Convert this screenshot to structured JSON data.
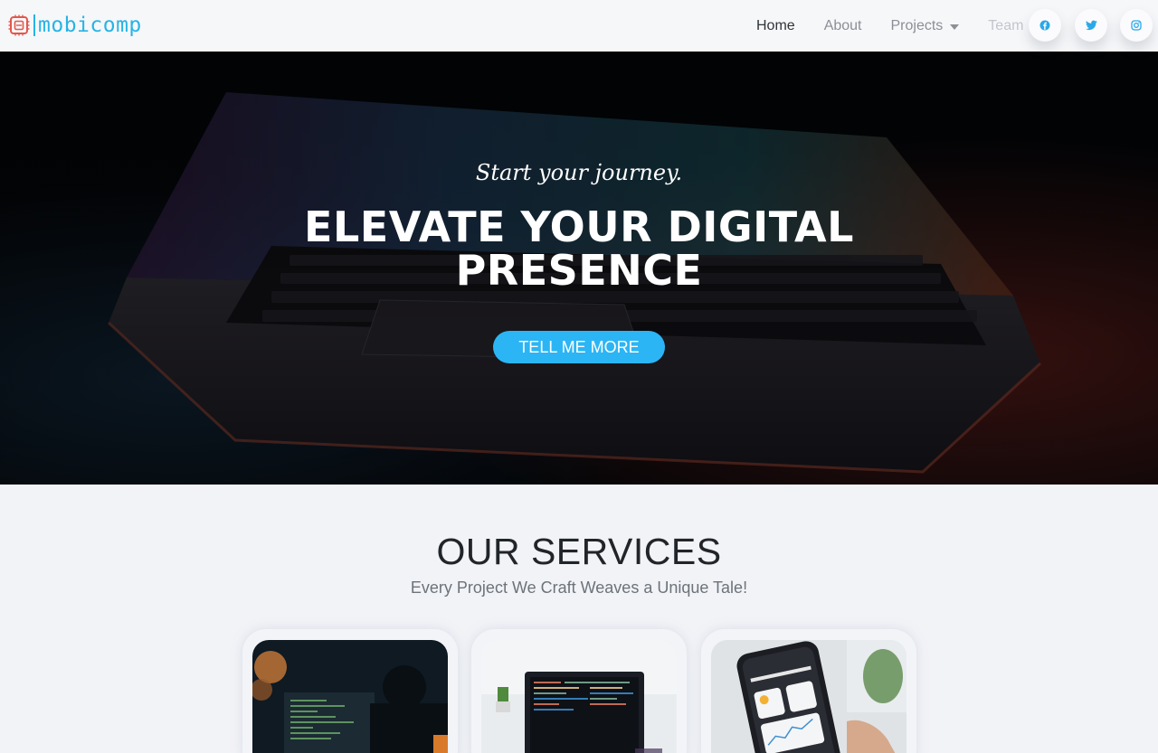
{
  "brand": {
    "name": "mobicomp",
    "logo_icon": "chip-icon"
  },
  "nav": {
    "items": [
      {
        "label": "Home",
        "state": "active"
      },
      {
        "label": "About",
        "state": "normal"
      },
      {
        "label": "Projects",
        "state": "dropdown"
      },
      {
        "label": "Team",
        "state": "faded"
      }
    ],
    "social": [
      {
        "icon": "facebook-icon"
      },
      {
        "icon": "twitter-icon"
      },
      {
        "icon": "instagram-icon"
      }
    ]
  },
  "hero": {
    "subheading": "Start your journey.",
    "heading_line1": "ELEVATE YOUR DIGITAL",
    "heading_line2": "PRESENCE",
    "cta_label": "TELL ME MORE"
  },
  "services": {
    "title": "OUR SERVICES",
    "subtitle": "Every Project We Craft Weaves a Unique Tale!",
    "cards": [
      {
        "image": "developer-monitors-photo"
      },
      {
        "image": "laptop-code-photo"
      },
      {
        "image": "phone-app-photo"
      }
    ]
  },
  "colors": {
    "accent": "#2bb5f4",
    "brand": "#26b4e6",
    "background": "#f2f3f7",
    "hero_bg": "#05070b"
  }
}
